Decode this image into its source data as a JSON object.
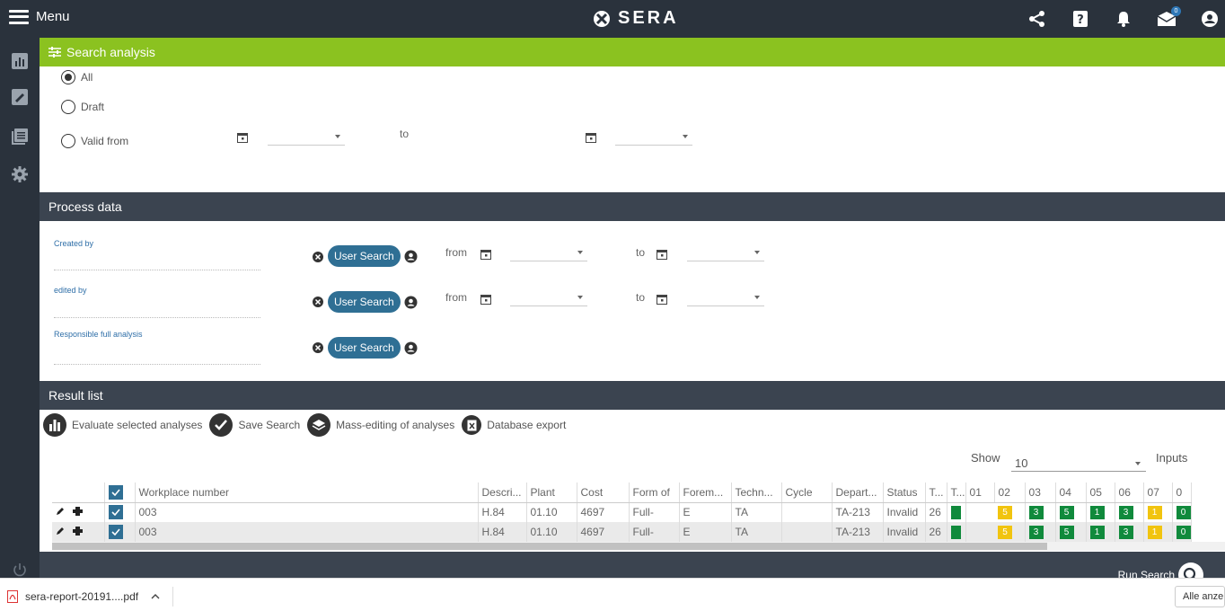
{
  "topbar": {
    "menu_label": "Menu",
    "logo_text": "SERA",
    "notif_count": "0"
  },
  "search_analysis": {
    "title": "Search analysis",
    "radio_all": "All",
    "radio_draft": "Draft",
    "radio_valid": "Valid from",
    "to_label": "to"
  },
  "process_data": {
    "title": "Process data",
    "created_by": "Created by",
    "edited_by": "edited by",
    "responsible": "Responsible full analysis",
    "user_search": "User Search",
    "from_label": "from",
    "to_label": "to"
  },
  "result_list": {
    "title": "Result list",
    "evaluate": "Evaluate selected analyses",
    "save_search": "Save Search",
    "mass_edit": "Mass-editing of analyses",
    "db_export": "Database export",
    "show_label": "Show",
    "show_value": "10",
    "inputs_label": "Inputs"
  },
  "table": {
    "headers": [
      "Workplace number",
      "Descri...",
      "Plant",
      "Cost",
      "Form of",
      "Forem...",
      "Techn...",
      "Cycle",
      "Depart...",
      "Status",
      "T...",
      "T...",
      "01",
      "02",
      "03",
      "04",
      "05",
      "06",
      "07",
      "0"
    ],
    "rows": [
      {
        "workplace": "003",
        "descr": "H.84",
        "plant": "01.10",
        "cost": "4697",
        "form": "Full-",
        "forem": "E",
        "techn": "TA",
        "cycle": "",
        "depart": "TA-213",
        "status": "Invalid",
        "t1": "26",
        "t2": "",
        "c01": "5",
        "c02": "3",
        "c03": "5",
        "c04": "1",
        "c05": "3",
        "c06": "1",
        "c07": "0"
      },
      {
        "workplace": "003",
        "descr": "H.84",
        "plant": "01.10",
        "cost": "4697",
        "form": "Full-",
        "forem": "E",
        "techn": "TA",
        "cycle": "",
        "depart": "TA-213",
        "status": "Invalid",
        "t1": "26",
        "t2": "",
        "c01": "5",
        "c02": "3",
        "c03": "5",
        "c04": "1",
        "c05": "3",
        "c06": "1",
        "c07": "0"
      }
    ]
  },
  "footer": {
    "run_search": "Run Search"
  },
  "download_bar": {
    "file_name": "sera-report-20191....pdf",
    "show_all": "Alle anzeigen"
  },
  "colors": {
    "accent_green": "#8bc220",
    "dark_bar": "#3b4450",
    "pill_blue": "#2f6f94",
    "cell_green": "#108a3c",
    "cell_yellow": "#f1c40f"
  }
}
